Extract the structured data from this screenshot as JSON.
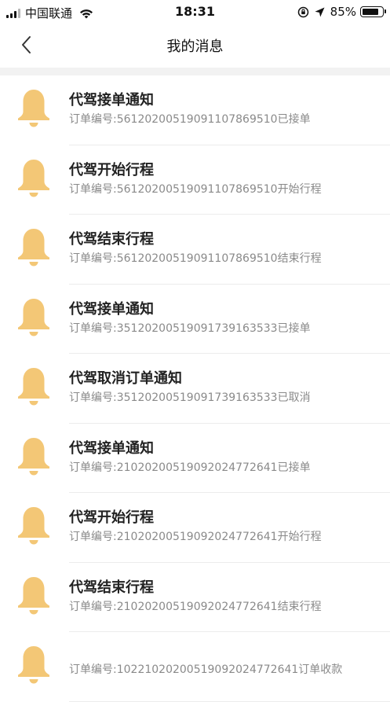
{
  "status_bar": {
    "carrier": "中国联通",
    "time": "18:31",
    "battery": "85%",
    "battery_level": 0.85
  },
  "nav": {
    "title": "我的消息"
  },
  "colors": {
    "bell": "#F3C776",
    "accent": "#F3C776"
  },
  "messages": [
    {
      "title": "代驾接单通知",
      "desc": "订单编号:561202005190911078695​10已接单"
    },
    {
      "title": "代驾开始行程",
      "desc": "订单编号:56120200519091107869510开始行程"
    },
    {
      "title": "代驾结束行程",
      "desc": "订单编号:56120200519091107869510结束行程"
    },
    {
      "title": "代驾接单通知",
      "desc": "订单编号:35120200519091739163533已接单"
    },
    {
      "title": "代驾取消订单通知",
      "desc": "订单编号:35120200519091739163533已取消"
    },
    {
      "title": "代驾接单通知",
      "desc": "订单编号:21020200519092024772641已接单"
    },
    {
      "title": "代驾开始行程",
      "desc": "订单编号:21020200519092024772641开始行程"
    },
    {
      "title": "代驾结束行程",
      "desc": "订单编号:21020200519092024772641结束行程"
    },
    {
      "title": "",
      "desc": "订单编号:1022102020051909202477264​1订单收款"
    }
  ]
}
